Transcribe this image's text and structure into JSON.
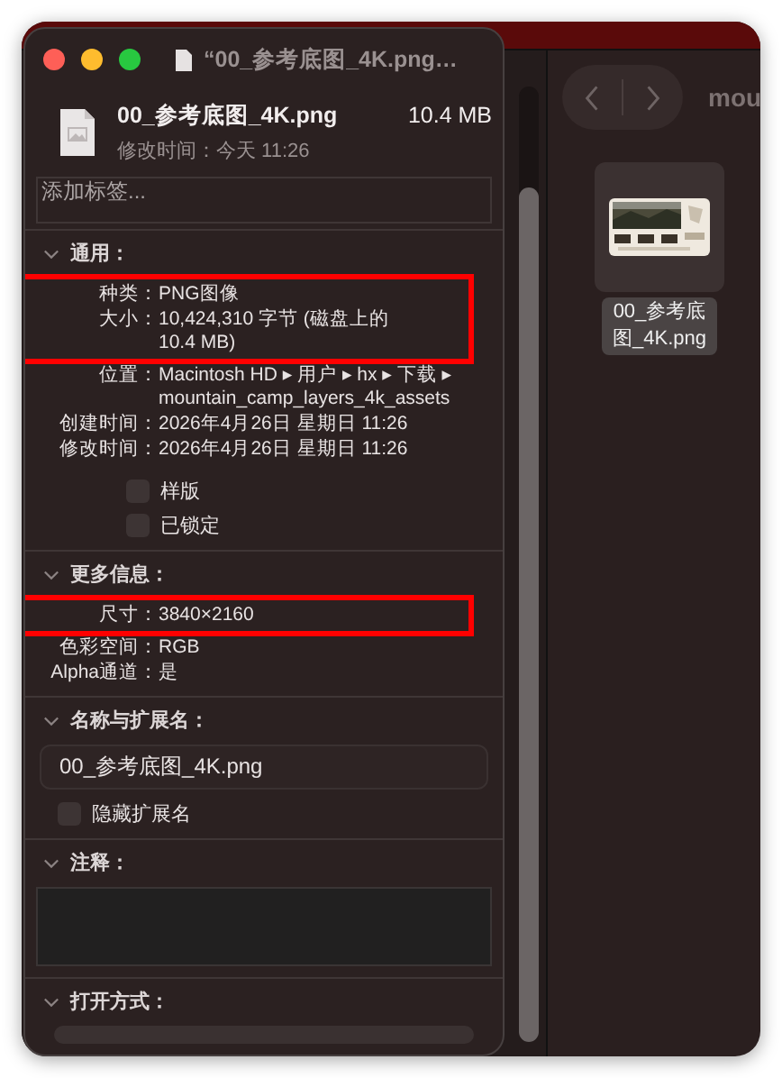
{
  "finder": {
    "path_title": "mou",
    "files": [
      {
        "name": "00_参考底图_4K.png",
        "selected": true
      }
    ]
  },
  "info_window": {
    "title": "“00_参考底图_4K.png…",
    "file_name": "00_参考底图_4K.png",
    "file_size": "10.4 MB",
    "modified": "修改时间：今天 11:26",
    "tags_placeholder": "添加标签...",
    "sections": [
      {
        "kind": "details",
        "title": "通用：",
        "expanded": true,
        "rows": [
          {
            "label": "种类：",
            "value": "PNG图像",
            "highlighted": true
          },
          {
            "label": "大小：",
            "value": "10,424,310 字节 (磁盘上的 10.4 MB)",
            "highlighted": true
          },
          {
            "label": "位置：",
            "value": "Macintosh HD ▸ 用户 ▸ hx ▸ 下载 ▸ mountain_camp_layers_4k_assets",
            "highlighted": false
          },
          {
            "label": "创建时间：",
            "value": "2026年4月26日 星期日 11:26",
            "highlighted": false
          },
          {
            "label": "修改时间：",
            "value": "2026年4月26日 星期日 11:26",
            "highlighted": false
          }
        ],
        "checkboxes": [
          {
            "label": "样版",
            "checked": false
          },
          {
            "label": "已锁定",
            "checked": false
          }
        ]
      },
      {
        "kind": "details",
        "title": "更多信息：",
        "expanded": true,
        "rows": [
          {
            "label": "尺寸：",
            "value": "3840×2160",
            "highlighted": true
          },
          {
            "label": "色彩空间：",
            "value": "RGB",
            "highlighted": false
          },
          {
            "label": "Alpha通道：",
            "value": "是",
            "highlighted": false
          }
        ]
      },
      {
        "kind": "name",
        "title": "名称与扩展名：",
        "expanded": true,
        "value": "00_参考底图_4K.png",
        "checkboxes": [
          {
            "label": "隐藏扩展名",
            "checked": false
          }
        ]
      },
      {
        "kind": "comments",
        "title": "注释：",
        "expanded": true
      },
      {
        "kind": "open_with",
        "title": "打开方式：",
        "expanded": true
      }
    ]
  }
}
